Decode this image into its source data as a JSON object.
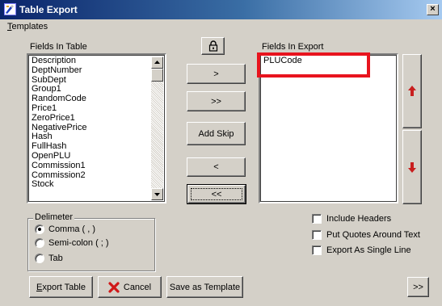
{
  "window": {
    "title": "Table Export",
    "close_glyph": "×"
  },
  "menu": {
    "templates_first": "T",
    "templates_rest": "emplates"
  },
  "fields_in_table": {
    "label": "Fields In Table",
    "items": [
      "Description",
      "DeptNumber",
      "SubDept",
      "Group1",
      "RandomCode",
      "Price1",
      "ZeroPrice1",
      "NegativePrice",
      "Hash",
      "FullHash",
      "OpenPLU",
      "Commission1",
      "Commission2",
      "Stock"
    ]
  },
  "fields_in_export": {
    "label": "Fields In Export",
    "items": [
      "PLUCode"
    ]
  },
  "buttons": {
    "add_one": ">",
    "add_all": ">>",
    "add_skip": "Add Skip",
    "remove_one": "<",
    "remove_all": "<<",
    "export_table_first": "E",
    "export_table_rest": "xport Table",
    "cancel": "Cancel",
    "save_template": "Save as Template",
    "more": ">>"
  },
  "delimeter": {
    "label": "Delimeter",
    "options": [
      "Comma ( , )",
      "Semi-colon ( ; )",
      "Tab"
    ],
    "selected": "Comma ( , )"
  },
  "options": {
    "include_headers": "Include Headers",
    "put_quotes": "Put Quotes Around Text",
    "single_line": "Export As Single Line"
  },
  "icons": {
    "lock": "lock-icon",
    "move_up": "arrow-up-icon",
    "move_down": "arrow-down-icon",
    "cancel": "red-x-icon"
  },
  "colors": {
    "highlight": "#e8141e",
    "arrow": "#c81e1e",
    "title_start": "#0a246a",
    "title_end": "#a6caf0"
  }
}
